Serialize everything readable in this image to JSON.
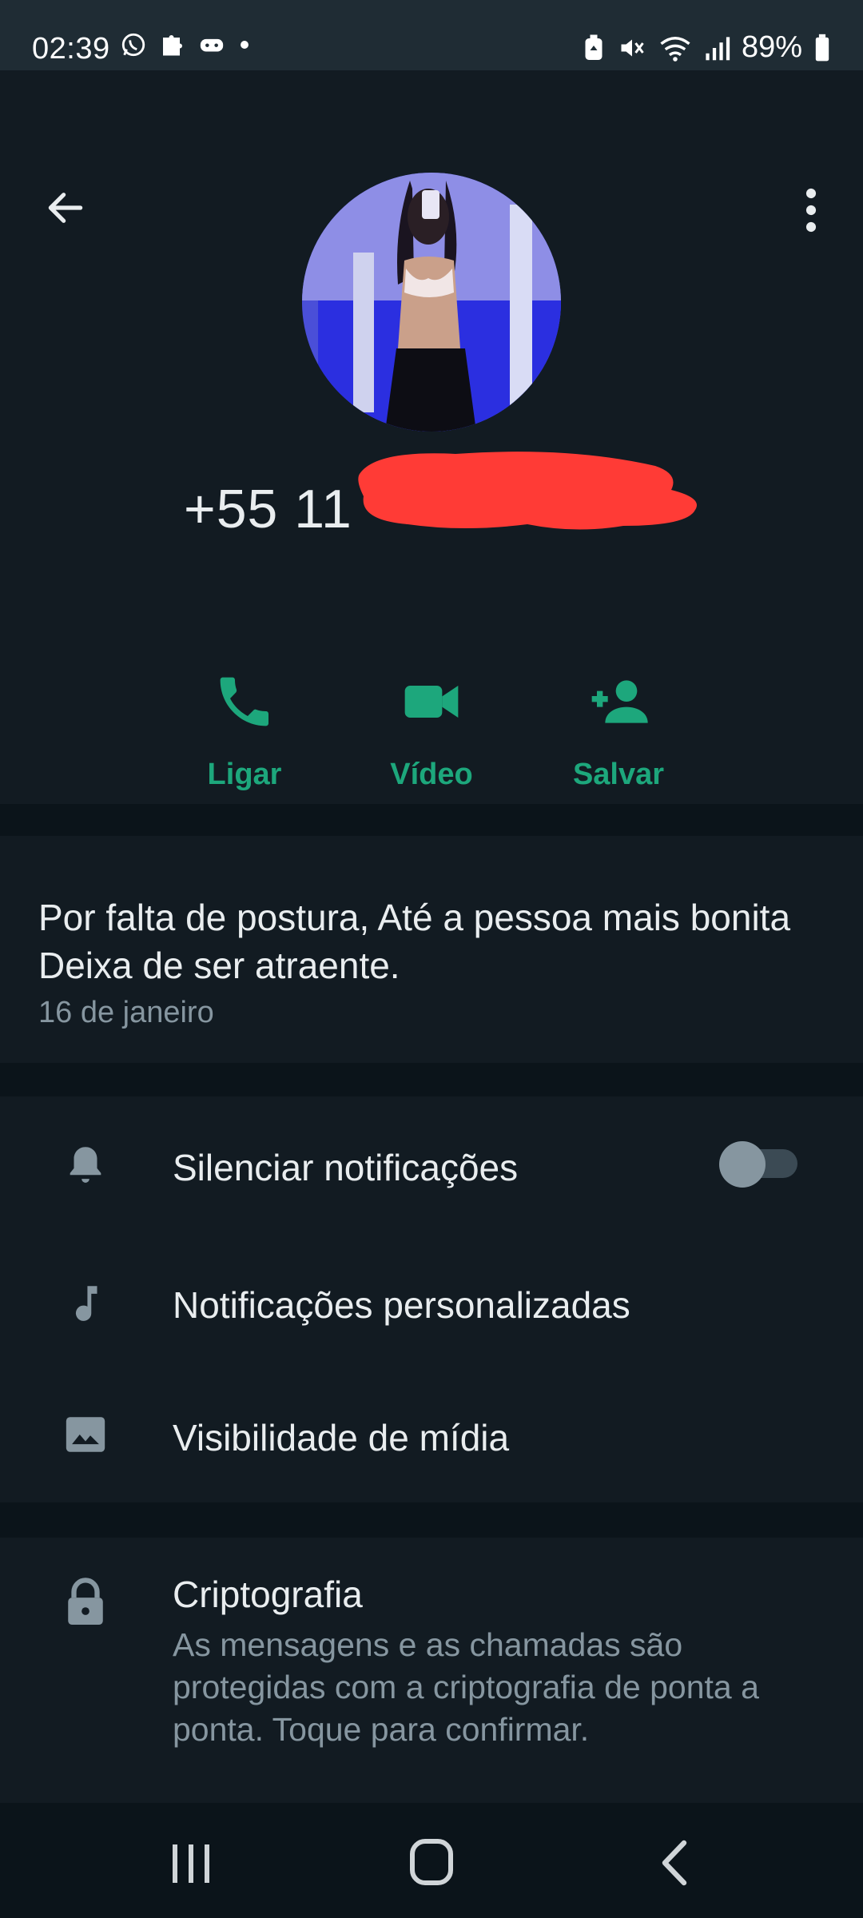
{
  "status_bar": {
    "time": "02:39",
    "battery": "89%"
  },
  "contact": {
    "phone_number": "+55 11"
  },
  "actions": [
    {
      "label": "Ligar",
      "icon": "phone-icon"
    },
    {
      "label": "Vídeo",
      "icon": "video-camera-icon"
    },
    {
      "label": "Salvar",
      "icon": "add-person-icon"
    }
  ],
  "about": {
    "text": "Por falta de postura, Até a pessoa mais bonita  Deixa de ser atraente.",
    "date": "16 de janeiro"
  },
  "settings": [
    {
      "label": "Silenciar notificações",
      "icon": "bell-icon",
      "toggle": false
    },
    {
      "label": "Notificações personalizadas",
      "icon": "music-note-icon"
    },
    {
      "label": "Visibilidade de mídia",
      "icon": "image-icon"
    }
  ],
  "encryption": {
    "title": "Criptografia",
    "description": "As mensagens e as chamadas são protegidas com a criptografia de ponta a ponta. Toque para confirmar.",
    "icon": "lock-icon"
  },
  "colors": {
    "accent": "#1da77c",
    "background": "#121b22",
    "status_bar": "#1f2c34",
    "redaction": "#ff3b36"
  }
}
